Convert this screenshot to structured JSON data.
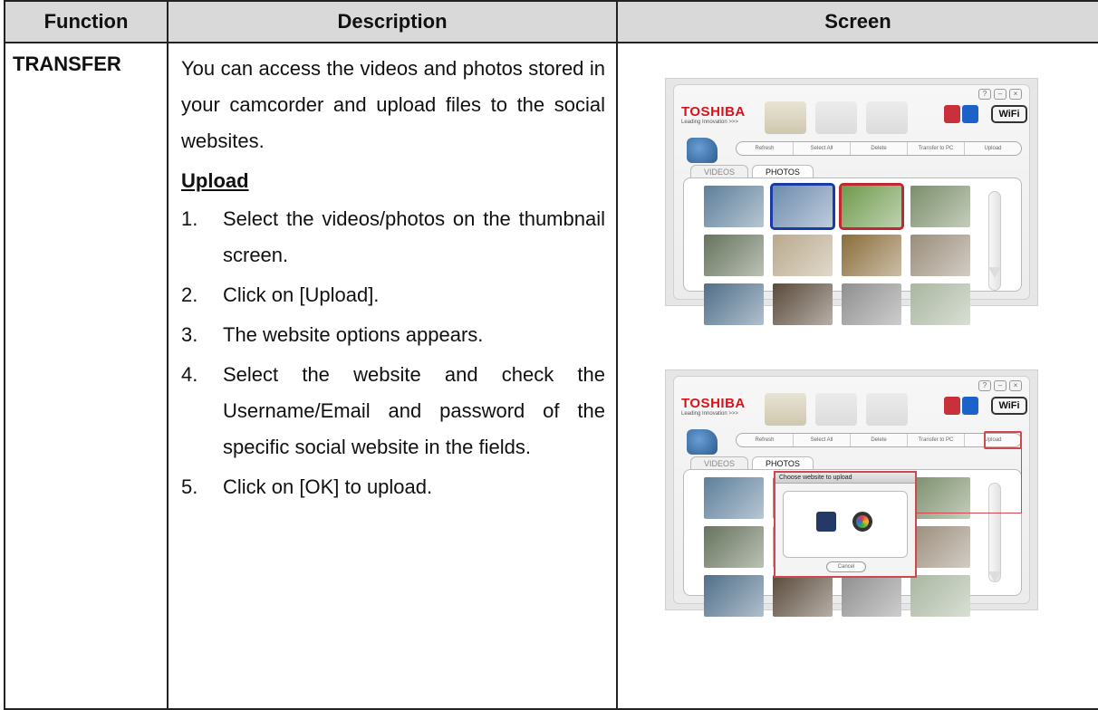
{
  "table": {
    "headers": {
      "function": "Function",
      "description": "Description",
      "screen": "Screen"
    }
  },
  "row": {
    "function": "TRANSFER",
    "intro": "You can access the videos and photos stored in your camcorder and upload files to the social websites.",
    "section_title": "Upload",
    "steps": [
      {
        "num": "1.",
        "text": "Select the videos/photos on the thumbnail screen."
      },
      {
        "num": "2.",
        "text": "Click on [Upload]."
      },
      {
        "num": "3.",
        "text": "The website options appears."
      },
      {
        "num": "4.",
        "text": "Select the website and check the Username/Email and password of the specific social website in the fields."
      },
      {
        "num": "5.",
        "text": "Click on [OK] to upload."
      }
    ]
  },
  "screenshots": {
    "brand": "TOSHIBA",
    "brand_tagline": "Leading Innovation >>>",
    "wifi_label": "WiFi",
    "window_buttons": [
      "?",
      "–",
      "×"
    ],
    "actions": [
      "Refresh",
      "Select All",
      "Delete",
      "Transfer to PC",
      "Upload"
    ],
    "tabs": [
      "VIDEOS",
      "PHOTOS"
    ],
    "dialog_title": "Choose website to upload",
    "dialog_cancel": "Cancel",
    "thumb_colors": [
      "#5d7f9a",
      "#6e8cae",
      "#6f9a4d",
      "#7b8e6a",
      "#66735c",
      "#b9a98c",
      "#8a6d3a",
      "#9a8d7a",
      "#4f6f8a",
      "#5a4a3a",
      "#8f8f8f",
      "#a9b6a0"
    ]
  }
}
